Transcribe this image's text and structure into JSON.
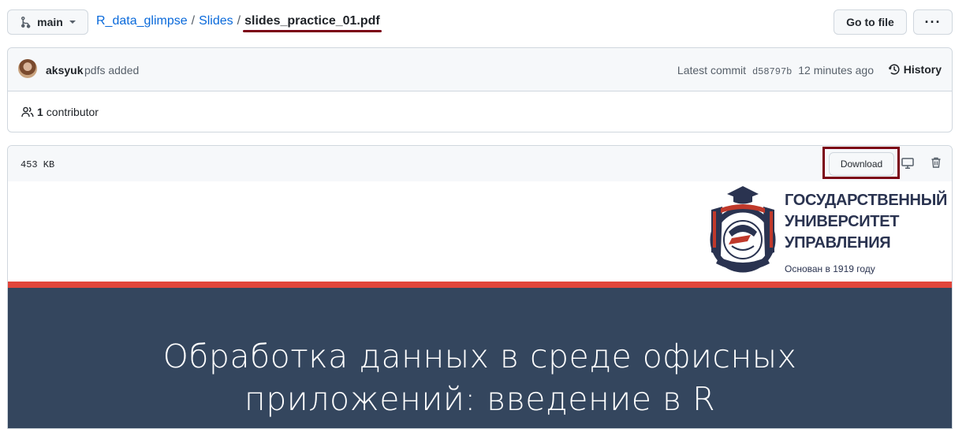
{
  "branch": {
    "name": "main"
  },
  "breadcrumb": {
    "repo": "R_data_glimpse",
    "folder": "Slides",
    "file": "slides_practice_01.pdf",
    "separator": "/"
  },
  "header_buttons": {
    "go_to_file": "Go to file",
    "more": "···"
  },
  "commit": {
    "author": "aksyuk",
    "message": "pdfs added",
    "latest_label": "Latest commit",
    "sha": "d58797b",
    "time": "12 minutes ago",
    "history_label": "History"
  },
  "contributors": {
    "count": "1",
    "label": "contributor"
  },
  "file": {
    "size": "453 KB",
    "download_label": "Download"
  },
  "slide": {
    "university_name": "ГОСУДАРСТВЕННЫЙ\nУНИВЕРСИТЕТ\nУПРАВЛЕНИЯ",
    "founded": "Основан в 1919 году",
    "title": "Обработка данных в среде офисных\nприложений: введение в R",
    "colors": {
      "accent_stripe": "#e2463b",
      "title_band": "#34465e",
      "logo_navy": "#2a3350"
    }
  },
  "colors": {
    "link": "#0969da",
    "highlight_frame": "#7b0014"
  }
}
